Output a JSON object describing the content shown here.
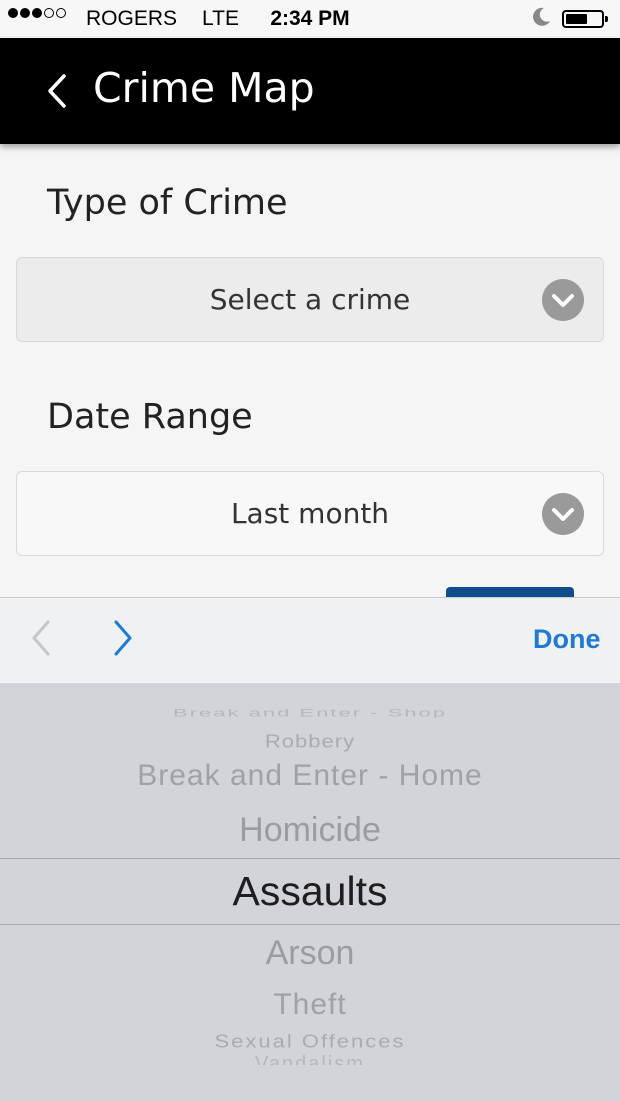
{
  "status_bar": {
    "carrier": "ROGERS",
    "network": "LTE",
    "time": "2:34 PM",
    "signal_dots": 3,
    "signal_total": 5,
    "battery_level": 0.55
  },
  "header": {
    "title": "Crime Map"
  },
  "form": {
    "crime_label": "Type of Crime",
    "crime_value": "Select a crime",
    "date_label": "Date Range",
    "date_value": "Last month"
  },
  "toolbar": {
    "done_label": "Done"
  },
  "picker": {
    "items": [
      "Break and Enter - Shop",
      "Robbery",
      "Break and Enter - Home",
      "Homicide",
      "Assaults",
      "Arson",
      "Theft",
      "Sexual Offences",
      "Vandalism"
    ],
    "selected": "Assaults"
  },
  "colors": {
    "accent": "#1f7ad1",
    "header_bg": "#000000",
    "button_blue": "#0f4d8c"
  }
}
